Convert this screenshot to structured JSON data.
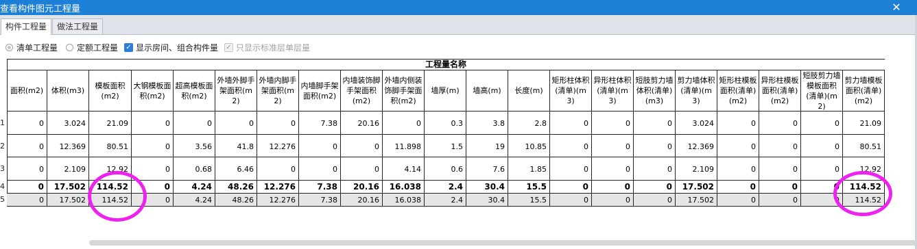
{
  "window": {
    "title": "查看构件图元工程量",
    "close_glyph": "✕"
  },
  "tabs": [
    {
      "label": "构件工程量",
      "active": true
    },
    {
      "label": "做法工程量",
      "active": false
    }
  ],
  "options": [
    {
      "label": "清单工程量",
      "type": "radio",
      "checked": true
    },
    {
      "label": "定额工程量",
      "type": "radio",
      "checked": false
    },
    {
      "label": "显示房间、组合构件量",
      "type": "checkbox",
      "checked": true
    },
    {
      "label": "只显示标准层单层量",
      "type": "checkbox",
      "checked": true,
      "disabled": true
    }
  ],
  "table": {
    "group_header": "工程量名称",
    "columns": [
      "面积(m2)",
      "体积(m3)",
      "模板面积(m2)",
      "大钢模板面积(m2)",
      "超高模板面积(m2)",
      "外墙外脚手架面积(m2)",
      "外墙内脚手架面积(m2)",
      "内墙脚手架面积(m2)",
      "内墙装饰脚手架面积(m2)",
      "外墙内侧装饰脚手架面积(m2)",
      "墙厚(m)",
      "墙高(m)",
      "长度(m)",
      "矩形柱体积(清单)(m3)",
      "异形柱体积(清单)(m3)",
      "短肢剪力墙体积(清单)(m3)",
      "剪力墙体积(清单)(m3)",
      "矩形柱模板面积(清单)(m2)",
      "异形柱模板面积(清单)(m2)",
      "短肢剪力墙模板面积(清单)(m2)",
      "剪力墙模板面积(清单)(m2)"
    ],
    "rows": [
      {
        "num": "1",
        "cells": [
          "0",
          "3.024",
          "21.09",
          "0",
          "0",
          "0",
          "0",
          "7.38",
          "20.16",
          "0",
          "0.3",
          "3.8",
          "2.8",
          "0",
          "0",
          "0",
          "3.024",
          "0",
          "0",
          "0",
          "21.09"
        ]
      },
      {
        "num": "2",
        "cells": [
          "0",
          "12.369",
          "80.51",
          "0",
          "3.56",
          "41.8",
          "12.276",
          "0",
          "0",
          "11.898",
          "1.5",
          "19",
          "10.85",
          "0",
          "0",
          "0",
          "12.369",
          "0",
          "0",
          "0",
          "80.51"
        ]
      },
      {
        "num": "3",
        "cells": [
          "0",
          "2.109",
          "12.92",
          "0",
          "0.68",
          "6.46",
          "0",
          "0",
          "0",
          "4.14",
          "0.6",
          "7.6",
          "1.85",
          "0",
          "0",
          "0",
          "2.109",
          "0",
          "0",
          "0",
          "12.92"
        ]
      },
      {
        "num": "4",
        "total": true,
        "cells": [
          "0",
          "17.502",
          "114.52",
          "0",
          "4.24",
          "48.26",
          "12.276",
          "7.38",
          "20.16",
          "16.038",
          "2.4",
          "30.4",
          "15.5",
          "0",
          "0",
          "0",
          "17.502",
          "0",
          "0",
          "0",
          "114.52"
        ]
      },
      {
        "num": "5",
        "grey": true,
        "cells": [
          "0",
          "17.502",
          "114.52",
          "0",
          "4.24",
          "48.26",
          "12.276",
          "7.38",
          "20.16",
          "16.038",
          "2.4",
          "30.4",
          "15.5",
          "0",
          "0",
          "0",
          "17.502",
          "0",
          "0",
          "0",
          "114.52"
        ]
      }
    ]
  },
  "colors": {
    "titlebar": "#1e7fd6",
    "annotation_circle": "#ee22ee",
    "checkbox_checked": "#2d7fd8"
  }
}
